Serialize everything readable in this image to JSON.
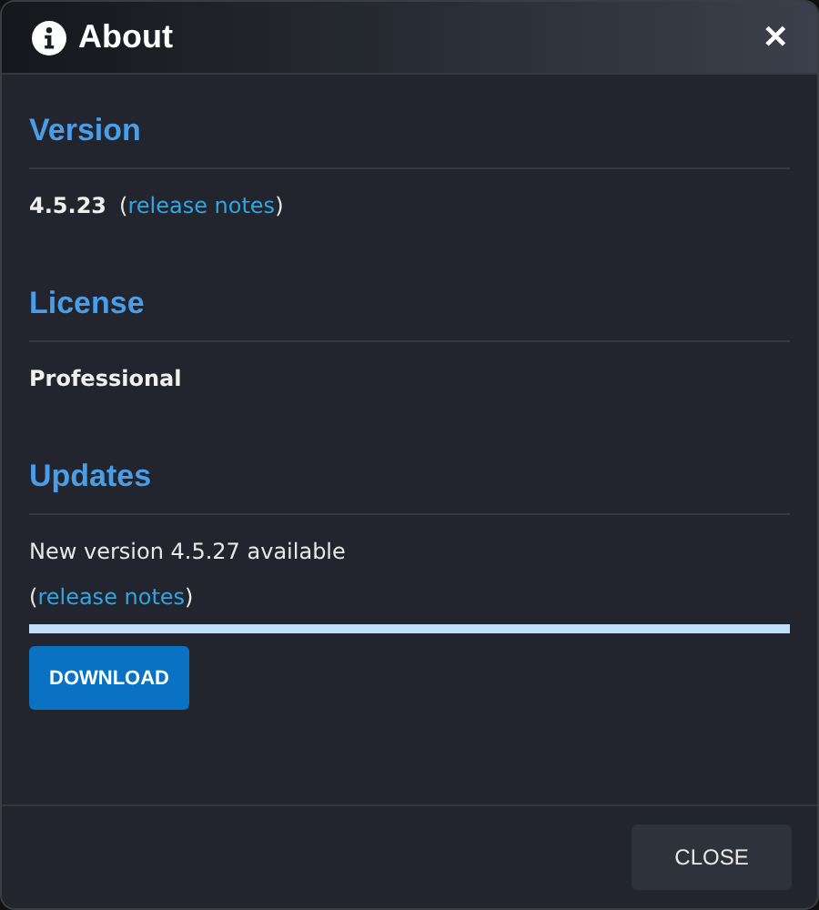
{
  "dialog": {
    "title": "About",
    "close_icon": "✕"
  },
  "sections": [
    {
      "kind": "version",
      "title": "Version",
      "value": "4.5.23",
      "notes": {
        "prefix": "(",
        "link": "release notes",
        "suffix": ")"
      }
    },
    {
      "kind": "license",
      "title": "License",
      "value": "Professional"
    },
    {
      "kind": "updates",
      "title": "Updates",
      "value": "New version 4.5.27 available",
      "notes": {
        "prefix": "(",
        "link": "release notes",
        "suffix": ")"
      },
      "progress": {
        "level": 1
      },
      "button": "DOWNLOAD"
    }
  ],
  "footer": {
    "button": "CLOSE"
  }
}
